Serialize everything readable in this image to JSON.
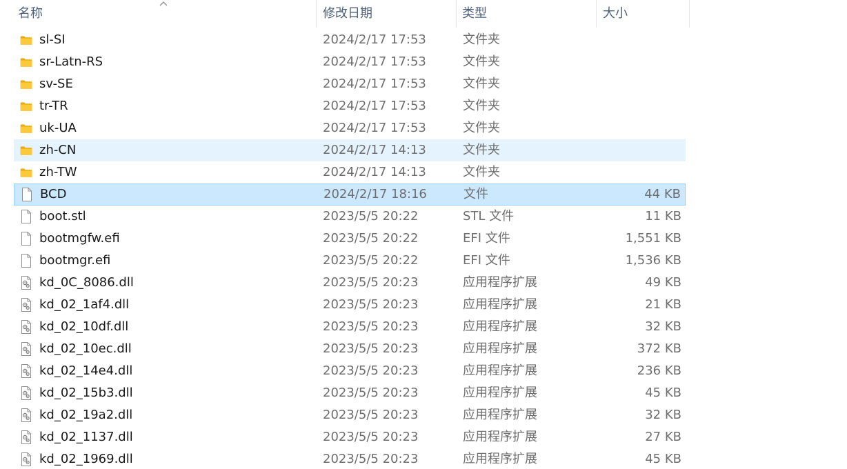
{
  "header": {
    "name_label": "名称",
    "date_label": "修改日期",
    "type_label": "类型",
    "size_label": "大小"
  },
  "rows": [
    {
      "icon": "folder-icon",
      "name": "sl-SI",
      "date": "2024/2/17 17:53",
      "type": "文件夹",
      "size": "",
      "state": ""
    },
    {
      "icon": "folder-icon",
      "name": "sr-Latn-RS",
      "date": "2024/2/17 17:53",
      "type": "文件夹",
      "size": "",
      "state": ""
    },
    {
      "icon": "folder-icon",
      "name": "sv-SE",
      "date": "2024/2/17 17:53",
      "type": "文件夹",
      "size": "",
      "state": ""
    },
    {
      "icon": "folder-icon",
      "name": "tr-TR",
      "date": "2024/2/17 17:53",
      "type": "文件夹",
      "size": "",
      "state": ""
    },
    {
      "icon": "folder-icon",
      "name": "uk-UA",
      "date": "2024/2/17 17:53",
      "type": "文件夹",
      "size": "",
      "state": ""
    },
    {
      "icon": "folder-icon",
      "name": "zh-CN",
      "date": "2024/2/17 14:13",
      "type": "文件夹",
      "size": "",
      "state": "hover"
    },
    {
      "icon": "folder-icon",
      "name": "zh-TW",
      "date": "2024/2/17 14:13",
      "type": "文件夹",
      "size": "",
      "state": ""
    },
    {
      "icon": "file-icon",
      "name": "BCD",
      "date": "2024/2/17 18:16",
      "type": "文件",
      "size": "44 KB",
      "state": "selected"
    },
    {
      "icon": "file-icon",
      "name": "boot.stl",
      "date": "2023/5/5 20:22",
      "type": "STL 文件",
      "size": "11 KB",
      "state": ""
    },
    {
      "icon": "file-icon",
      "name": "bootmgfw.efi",
      "date": "2023/5/5 20:22",
      "type": "EFI 文件",
      "size": "1,551 KB",
      "state": ""
    },
    {
      "icon": "file-icon",
      "name": "bootmgr.efi",
      "date": "2023/5/5 20:22",
      "type": "EFI 文件",
      "size": "1,536 KB",
      "state": ""
    },
    {
      "icon": "dll-icon",
      "name": "kd_0C_8086.dll",
      "date": "2023/5/5 20:23",
      "type": "应用程序扩展",
      "size": "49 KB",
      "state": ""
    },
    {
      "icon": "dll-icon",
      "name": "kd_02_1af4.dll",
      "date": "2023/5/5 20:23",
      "type": "应用程序扩展",
      "size": "21 KB",
      "state": ""
    },
    {
      "icon": "dll-icon",
      "name": "kd_02_10df.dll",
      "date": "2023/5/5 20:23",
      "type": "应用程序扩展",
      "size": "32 KB",
      "state": ""
    },
    {
      "icon": "dll-icon",
      "name": "kd_02_10ec.dll",
      "date": "2023/5/5 20:23",
      "type": "应用程序扩展",
      "size": "372 KB",
      "state": ""
    },
    {
      "icon": "dll-icon",
      "name": "kd_02_14e4.dll",
      "date": "2023/5/5 20:23",
      "type": "应用程序扩展",
      "size": "236 KB",
      "state": ""
    },
    {
      "icon": "dll-icon",
      "name": "kd_02_15b3.dll",
      "date": "2023/5/5 20:23",
      "type": "应用程序扩展",
      "size": "45 KB",
      "state": ""
    },
    {
      "icon": "dll-icon",
      "name": "kd_02_19a2.dll",
      "date": "2023/5/5 20:23",
      "type": "应用程序扩展",
      "size": "32 KB",
      "state": ""
    },
    {
      "icon": "dll-icon",
      "name": "kd_02_1137.dll",
      "date": "2023/5/5 20:23",
      "type": "应用程序扩展",
      "size": "27 KB",
      "state": ""
    },
    {
      "icon": "dll-icon",
      "name": "kd_02_1969.dll",
      "date": "2023/5/5 20:23",
      "type": "应用程序扩展",
      "size": "45 KB",
      "state": ""
    }
  ]
}
